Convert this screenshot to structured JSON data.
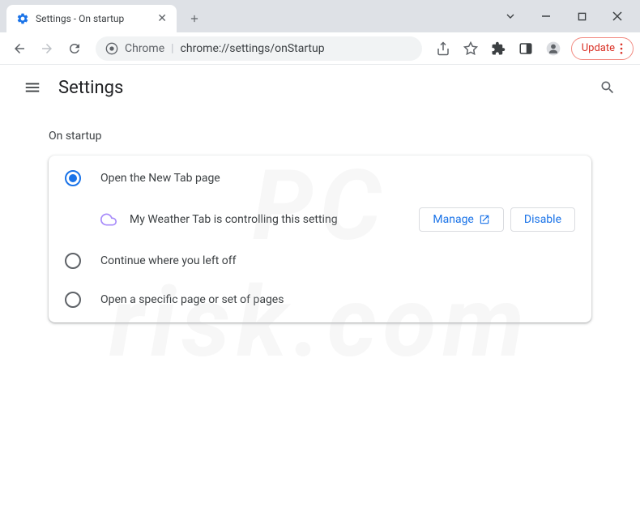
{
  "window": {
    "tab_title": "Settings - On startup"
  },
  "toolbar": {
    "omnibox_prefix": "Chrome",
    "omnibox_url": "chrome://settings/onStartup",
    "update_label": "Update"
  },
  "header": {
    "title": "Settings"
  },
  "content": {
    "section_title": "On startup",
    "options": [
      {
        "label": "Open the New Tab page",
        "selected": true
      },
      {
        "label": "Continue where you left off",
        "selected": false
      },
      {
        "label": "Open a specific page or set of pages",
        "selected": false
      }
    ],
    "extension_notice": {
      "text": "My Weather Tab is controlling this setting",
      "manage_label": "Manage",
      "disable_label": "Disable"
    }
  }
}
